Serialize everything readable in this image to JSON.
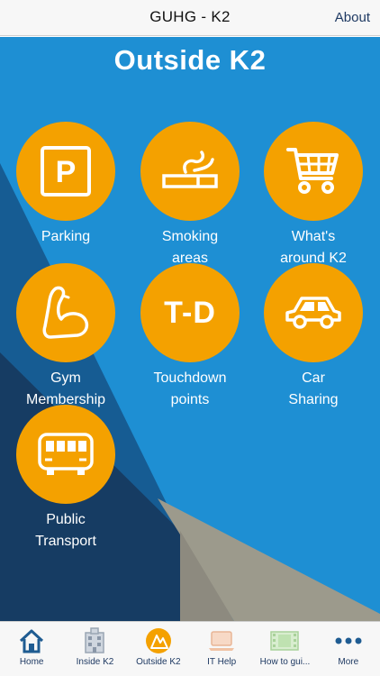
{
  "navbar": {
    "title": "GUHG - K2",
    "about_label": "About"
  },
  "page": {
    "title": "Outside K2"
  },
  "tiles": [
    {
      "label": "Parking",
      "icon": "parking-icon"
    },
    {
      "label": "Smoking\nareas",
      "icon": "cigarette-icon"
    },
    {
      "label": "What's\naround K2",
      "icon": "shopping-cart-icon"
    },
    {
      "label": "Gym\nMembership",
      "icon": "flexed-arm-icon"
    },
    {
      "label": "Touchdown\npoints",
      "icon": "touchdown-icon",
      "icon_text": "T-D"
    },
    {
      "label": "Car\nSharing",
      "icon": "car-icon"
    },
    {
      "label": "Public\nTransport",
      "icon": "bus-icon"
    }
  ],
  "parking_glyph": "P",
  "tabs": [
    {
      "label": "Home",
      "icon": "home-icon"
    },
    {
      "label": "Inside K2",
      "icon": "building-icon"
    },
    {
      "label": "Outside K2",
      "icon": "outside-k2-icon"
    },
    {
      "label": "IT Help",
      "icon": "laptop-icon"
    },
    {
      "label": "How to gui...",
      "icon": "film-icon"
    },
    {
      "label": "More",
      "icon": "more-dots-icon"
    }
  ],
  "colors": {
    "accent_orange": "#f4a100",
    "background_blue": "#1f8fd2",
    "dark_navy": "#16385f",
    "nav_text": "#1f3a63"
  }
}
